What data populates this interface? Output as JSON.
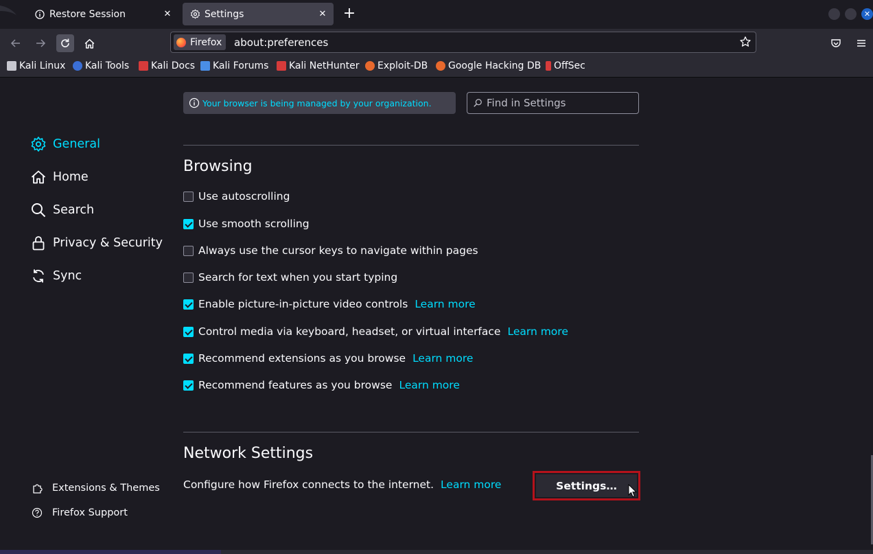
{
  "tabs": [
    {
      "title": "Restore Session",
      "icon": "info-icon"
    },
    {
      "title": "Settings",
      "icon": "gear-icon",
      "active": true
    }
  ],
  "navbar": {
    "identity_label": "Firefox",
    "url": "about:preferences"
  },
  "bookmarks": [
    {
      "label": "Kali Linux",
      "icon": "kali-dragon-icon",
      "color": "#c8c8d0"
    },
    {
      "label": "Kali Tools",
      "icon": "kali-tools-icon",
      "color": "#3b6fd6"
    },
    {
      "label": "Kali Docs",
      "icon": "kali-docs-icon",
      "color": "#d63b3b"
    },
    {
      "label": "Kali Forums",
      "icon": "kali-forums-icon",
      "color": "#4a8ee6"
    },
    {
      "label": "Kali NetHunter",
      "icon": "nethunter-icon",
      "color": "#d63b3b"
    },
    {
      "label": "Exploit-DB",
      "icon": "exploit-db-icon",
      "color": "#e8692d"
    },
    {
      "label": "Google Hacking DB",
      "icon": "ghdb-icon",
      "color": "#e8692d"
    },
    {
      "label": "OffSec",
      "icon": "offsec-icon",
      "color": "#d63b3b"
    }
  ],
  "notice": "Your browser is being managed by your organization.",
  "search": {
    "placeholder": "Find in Settings"
  },
  "sidebar": {
    "categories": [
      {
        "label": "General",
        "icon": "gear-icon",
        "active": true
      },
      {
        "label": "Home",
        "icon": "home-icon"
      },
      {
        "label": "Search",
        "icon": "search-icon"
      },
      {
        "label": "Privacy & Security",
        "icon": "lock-icon"
      },
      {
        "label": "Sync",
        "icon": "sync-icon"
      }
    ],
    "footer": [
      {
        "label": "Extensions & Themes",
        "icon": "puzzle-icon"
      },
      {
        "label": "Firefox Support",
        "icon": "help-icon"
      }
    ]
  },
  "browsing": {
    "heading": "Browsing",
    "options": [
      {
        "label": "Use autoscrolling",
        "checked": false,
        "learn": ""
      },
      {
        "label": "Use smooth scrolling",
        "checked": true,
        "learn": ""
      },
      {
        "label": "Always use the cursor keys to navigate within pages",
        "checked": false,
        "learn": ""
      },
      {
        "label": "Search for text when you start typing",
        "checked": false,
        "learn": ""
      },
      {
        "label": "Enable picture-in-picture video controls",
        "checked": true,
        "learn": "Learn more"
      },
      {
        "label": "Control media via keyboard, headset, or virtual interface",
        "checked": true,
        "learn": "Learn more"
      },
      {
        "label": "Recommend extensions as you browse",
        "checked": true,
        "learn": "Learn more"
      },
      {
        "label": "Recommend features as you browse",
        "checked": true,
        "learn": "Learn more"
      }
    ]
  },
  "network": {
    "heading": "Network Settings",
    "description": "Configure how Firefox connects to the internet.",
    "learn": "Learn more",
    "button": "Settings…"
  },
  "colors": {
    "accent": "#00ddff",
    "background": "#1c1b22",
    "highlight_border": "#b5121b"
  }
}
